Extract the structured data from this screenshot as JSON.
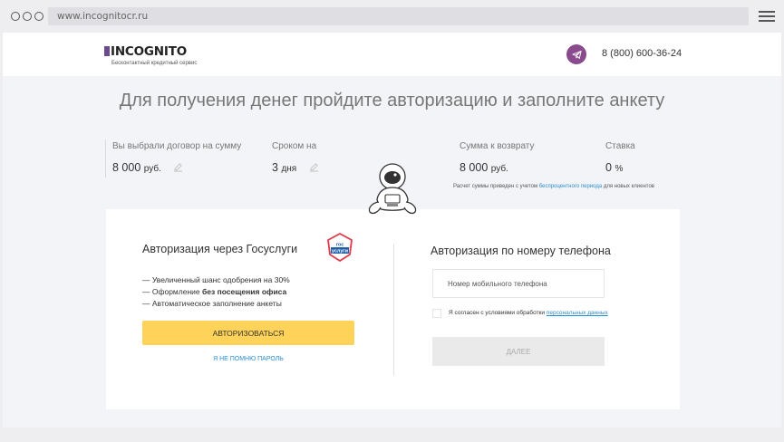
{
  "browser": {
    "url": "www.incognitocr.ru"
  },
  "header": {
    "logo_text": "INCOGNITO",
    "logo_tagline": "Бесконтактный кредитный сервис",
    "phone": "8 (800) 600-36-24"
  },
  "headline": "Для получения денег пройдите авторизацию и заполните анкету",
  "summary": {
    "amount_label": "Вы выбрали договор на сумму",
    "amount_value": "8 000",
    "amount_unit": "руб.",
    "term_label": "Сроком на",
    "term_value": "3",
    "term_unit": "дня",
    "repay_label": "Сумма к возврату",
    "repay_value": "8 000",
    "repay_unit": "руб.",
    "rate_label": "Ставка",
    "rate_value": "0",
    "rate_unit": "%",
    "note_prefix": "Расчет суммы приведен с учетом",
    "note_link": "беспроцентного периода",
    "note_suffix": "для новых клиентов"
  },
  "gosuslugi": {
    "title": "Авторизация через Госуслуги",
    "logo_line1": "гос",
    "logo_line2": "услуги",
    "bullet1": "— Увеличенный шанс одобрения на 30%",
    "bullet2_prefix": "— Оформление",
    "bullet2_bold": "без посещения офиса",
    "bullet3": "— Автоматическое заполнение анкеты",
    "button": "АВТОРИЗОВАТЬСЯ",
    "forgot": "Я НЕ ПОМНЮ ПАРОЛЬ"
  },
  "phone_auth": {
    "title": "Авторизация по номеру телефона",
    "input_placeholder": "Номер мобильного телефона",
    "agree_prefix": "Я согласен с условиями обработки",
    "agree_link": "персональных данных",
    "button": "ДАЛЕЕ"
  },
  "colors": {
    "accent_yellow": "#ffd35a",
    "brand_purple": "#8a4a8e",
    "link_blue": "#2a8fd0"
  }
}
